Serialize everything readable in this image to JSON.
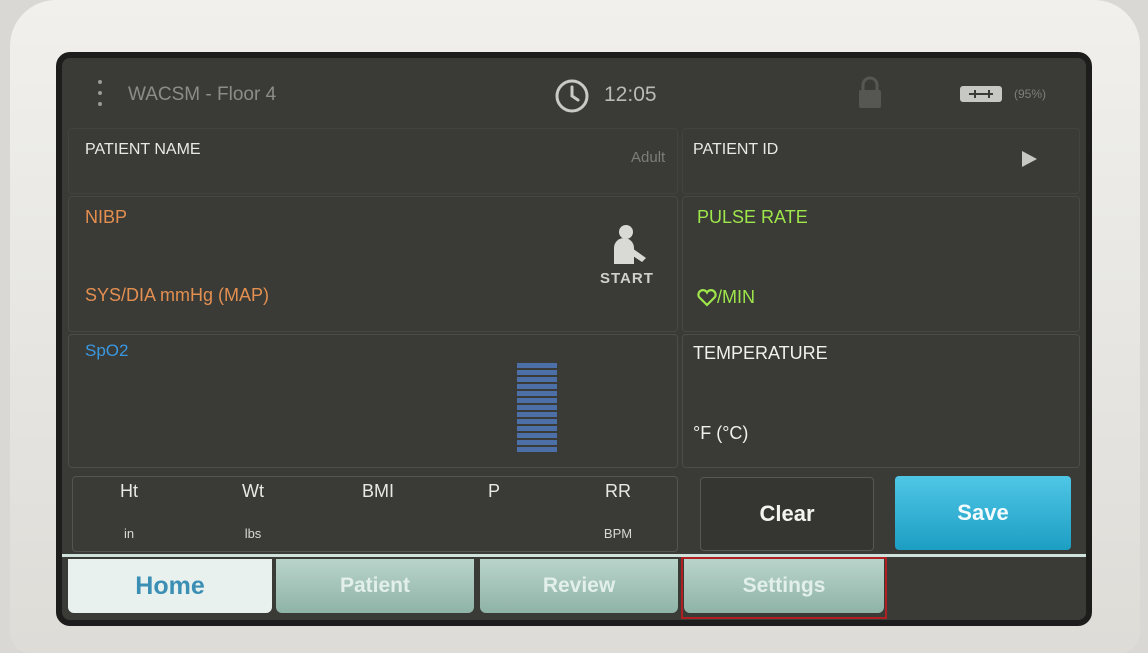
{
  "status_bar": {
    "location": "WACSM - Floor 4",
    "time": "12:05",
    "battery_percent": "(95%)"
  },
  "patient": {
    "name_label": "PATIENT NAME",
    "category": "Adult",
    "id_label": "PATIENT ID"
  },
  "nibp": {
    "label": "NIBP",
    "units": "SYS/DIA mmHg (MAP)",
    "start_label": "START"
  },
  "pulse": {
    "label": "PULSE RATE",
    "units": "/MIN"
  },
  "spo2": {
    "label": "SpO2"
  },
  "temperature": {
    "label": "TEMPERATURE",
    "units": "°F (°C)"
  },
  "misc": [
    {
      "label": "Ht",
      "unit": "in"
    },
    {
      "label": "Wt",
      "unit": "lbs"
    },
    {
      "label": "BMI",
      "unit": ""
    },
    {
      "label": "P",
      "unit": ""
    },
    {
      "label": "RR",
      "unit": "BPM"
    }
  ],
  "actions": {
    "clear": "Clear",
    "save": "Save"
  },
  "tabs": [
    {
      "label": "Home",
      "active": true
    },
    {
      "label": "Patient",
      "active": false
    },
    {
      "label": "Review",
      "active": false
    },
    {
      "label": "Settings",
      "active": false
    }
  ],
  "colors": {
    "nibp": "#e38f50",
    "pulse": "#9ee64a",
    "spo2": "#3b97e0",
    "save": "#1c9ec3",
    "highlight": "#b01f22"
  }
}
